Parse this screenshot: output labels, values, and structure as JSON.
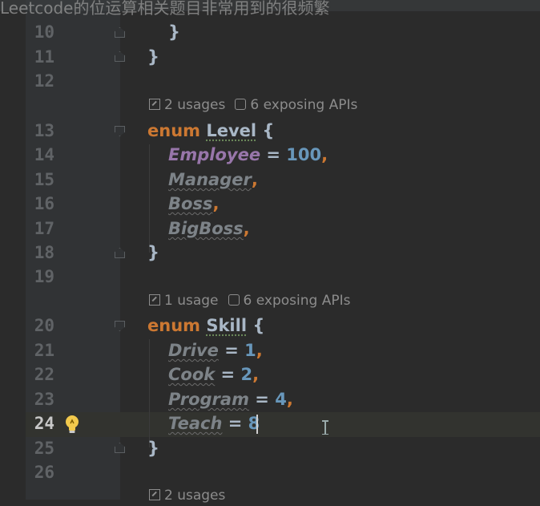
{
  "overlay_caption": "Leetcode的位运算相关题目非常用到的很频繁",
  "line_numbers": [
    "10",
    "11",
    "12",
    "13",
    "14",
    "15",
    "16",
    "17",
    "18",
    "19",
    "20",
    "21",
    "22",
    "23",
    "24",
    "25",
    "26"
  ],
  "current_line": "24",
  "hints": {
    "level_usages": "2 usages",
    "level_apis": "6 exposing APIs",
    "skill_usages": "1 usage",
    "skill_apis": "6 exposing APIs",
    "next_usages": "2 usages"
  },
  "code": {
    "brace_close": "}",
    "enum_kw": "enum",
    "level_name": "Level",
    "open_brace": " {",
    "employee": "Employee",
    "employee_value": "100",
    "manager": "Manager",
    "boss": "Boss",
    "bigboss": "BigBoss",
    "skill_name": "Skill",
    "drive": "Drive",
    "drive_value": "1",
    "cook": "Cook",
    "cook_value": "2",
    "program": "Program",
    "program_value": "4",
    "teach": "Teach",
    "teach_value": "8",
    "assign": " = ",
    "comma": ","
  },
  "colors": {
    "keyword": "#cc7832",
    "number": "#6897bb",
    "member": "#9876aa",
    "background": "#2b2b2b",
    "gutter": "#313335"
  }
}
